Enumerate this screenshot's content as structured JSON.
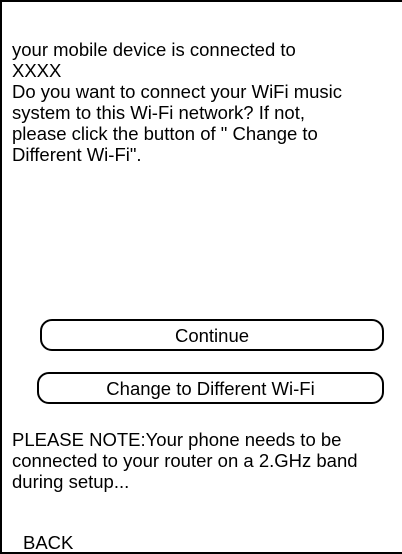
{
  "intro": {
    "lines": [
      "your mobile device is connected to",
      "XXXX",
      "Do you want to connect your WiFi music",
      "system to this Wi-Fi network? If not,",
      "please click the button of \" Change to",
      "Different Wi-Fi\"."
    ]
  },
  "buttons": {
    "continue_label": "Continue",
    "change_wifi_label": "Change to Different Wi-Fi"
  },
  "note": {
    "lines": [
      "PLEASE NOTE:Your phone needs to be",
      "connected to your router on a 2.GHz band",
      "during setup..."
    ]
  },
  "back_label": "BACK"
}
